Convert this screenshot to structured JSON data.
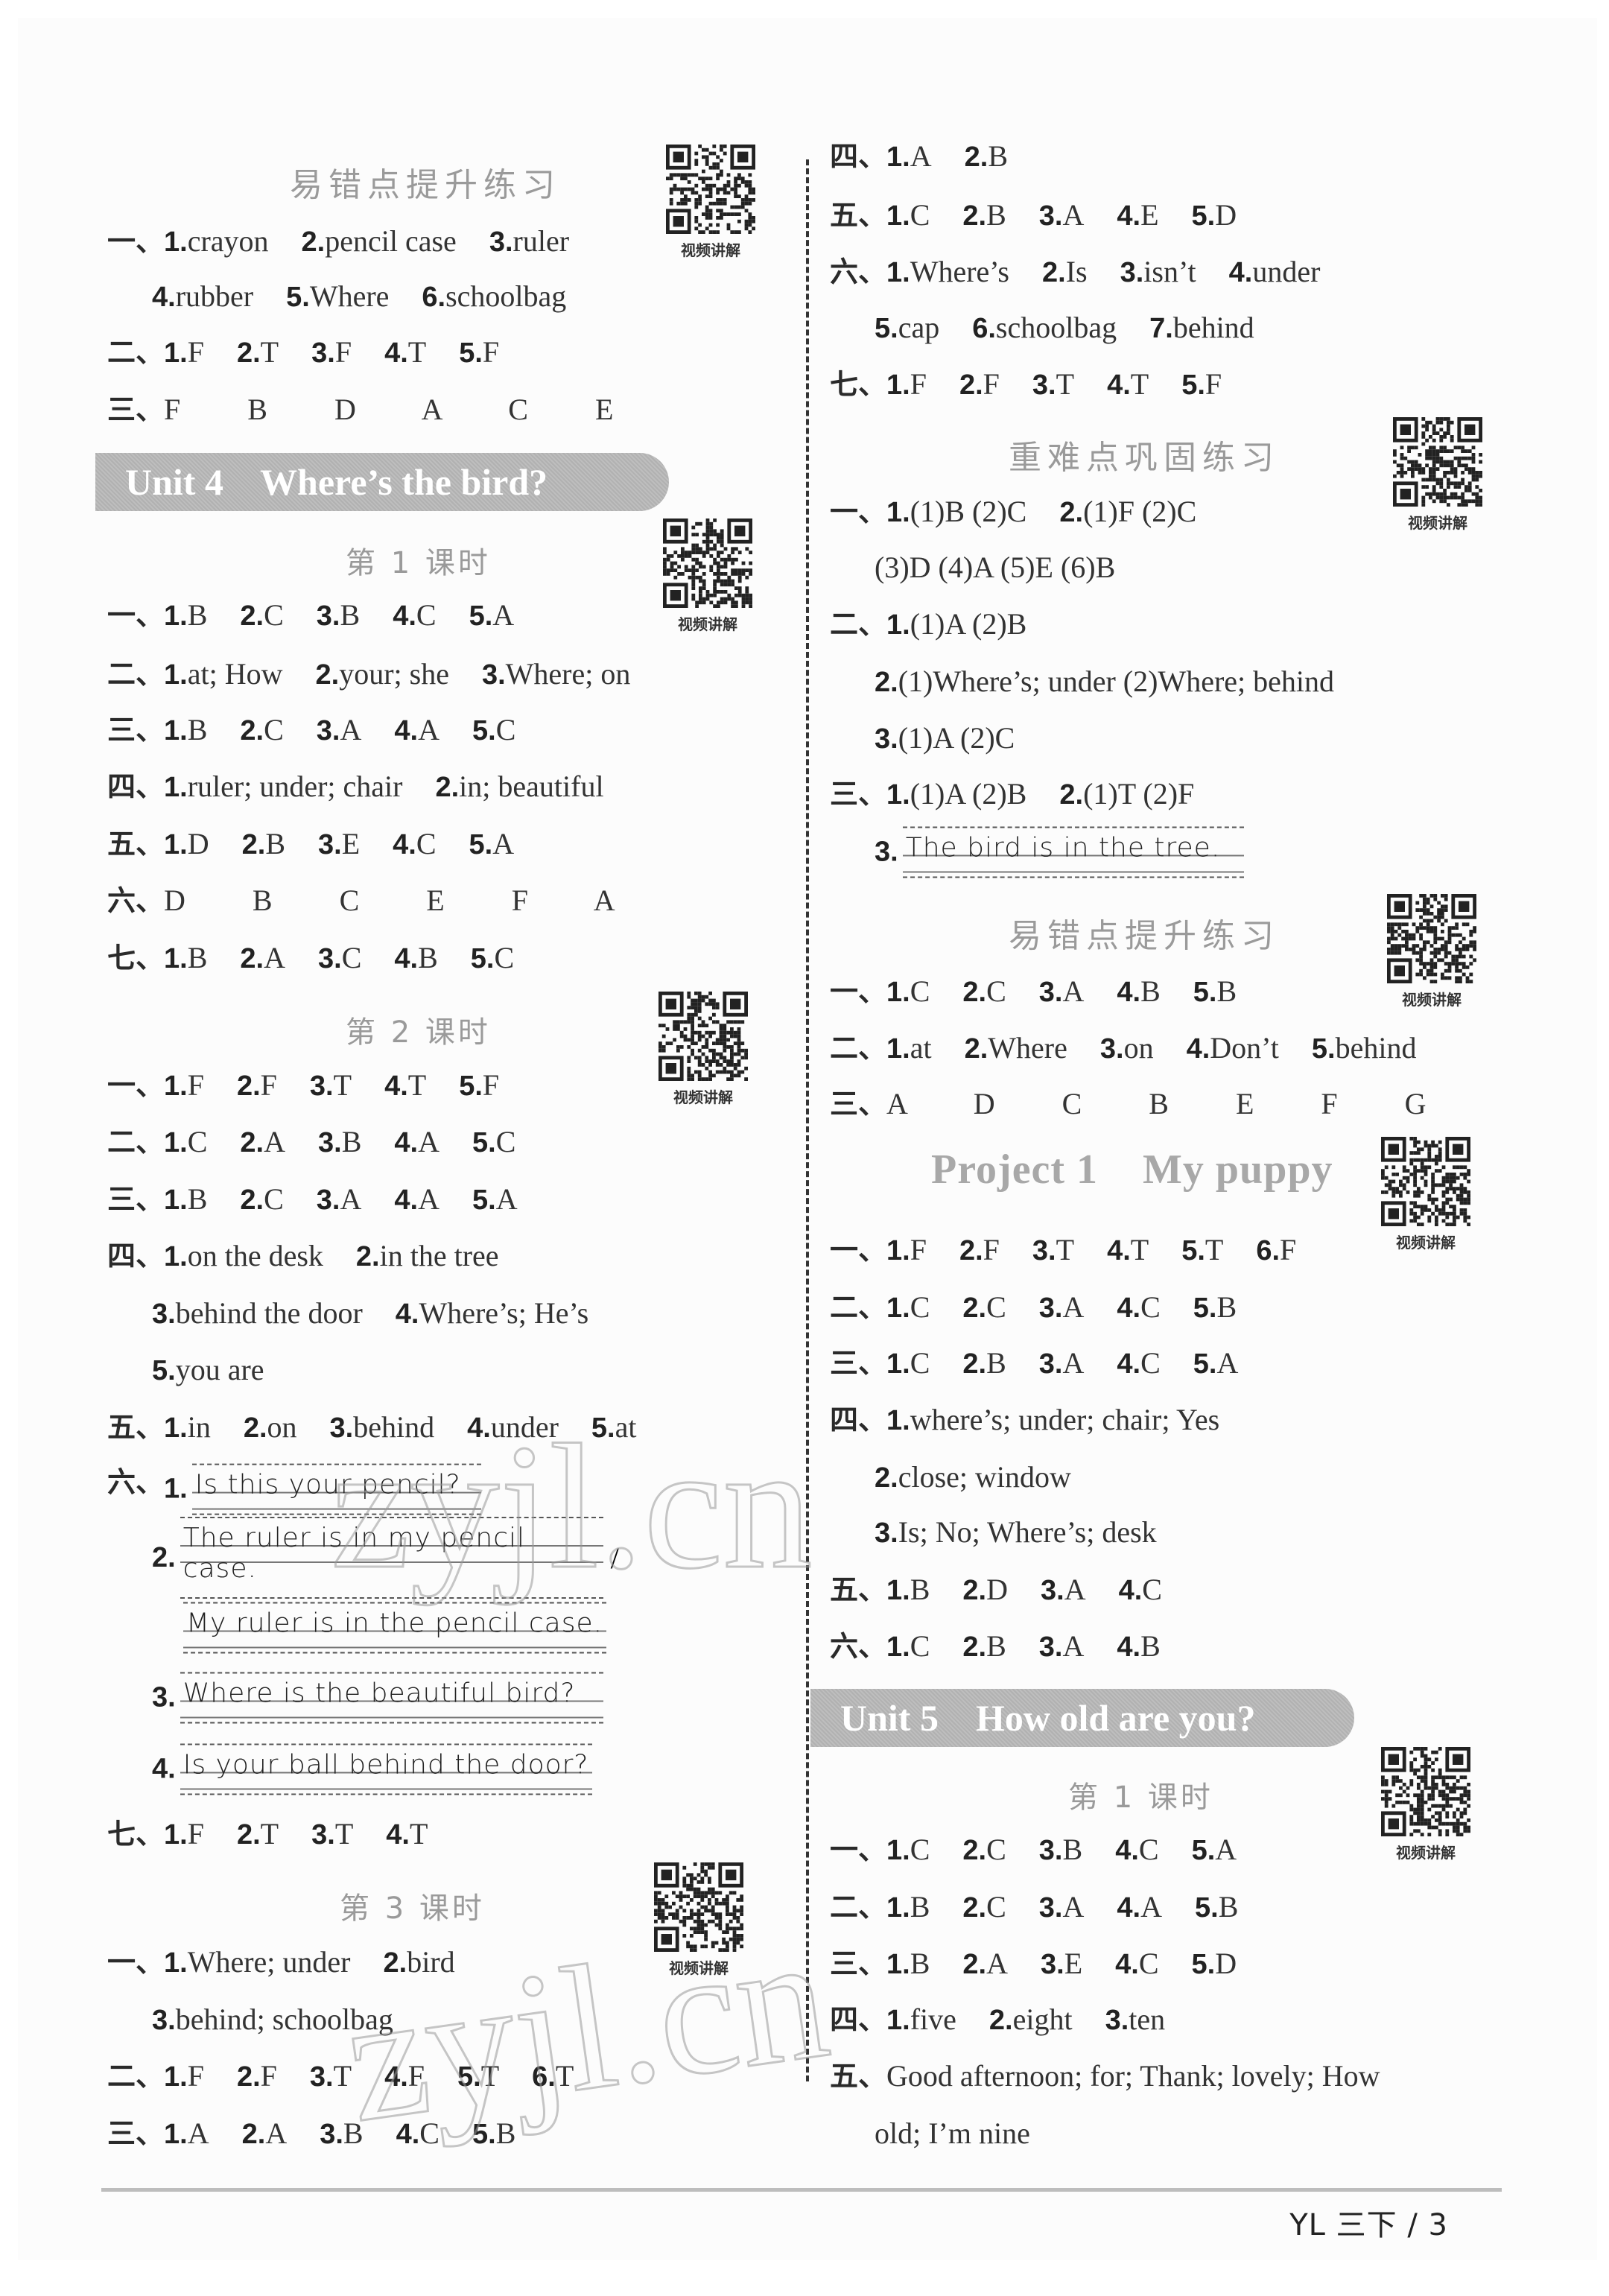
{
  "footer": "YL 三下 / 3",
  "qr_label": "视频讲解",
  "watermark": "zyjl.cn",
  "left": {
    "section_error1": "易错点提升练习",
    "error1_rows": [
      {
        "marker": "一、",
        "items": [
          {
            "n": "1.",
            "a": "crayon"
          },
          {
            "n": "2.",
            "a": "pencil case"
          },
          {
            "n": "3.",
            "a": "ruler"
          }
        ]
      },
      {
        "marker": "",
        "items": [
          {
            "n": "4.",
            "a": "rubber"
          },
          {
            "n": "5.",
            "a": "Where"
          },
          {
            "n": "6.",
            "a": "schoolbag"
          }
        ]
      },
      {
        "marker": "二、",
        "items": [
          {
            "n": "1.",
            "a": "F"
          },
          {
            "n": "2.",
            "a": "T"
          },
          {
            "n": "3.",
            "a": "F"
          },
          {
            "n": "4.",
            "a": "T"
          },
          {
            "n": "5.",
            "a": "F"
          }
        ]
      },
      {
        "marker": "三、",
        "letters": "F B D A C E"
      }
    ],
    "unit4_banner": "Unit 4    Where’s the bird?",
    "lesson1_title": "第 1 课时",
    "lesson1_rows": [
      {
        "marker": "一、",
        "items": [
          {
            "n": "1.",
            "a": "B"
          },
          {
            "n": "2.",
            "a": "C"
          },
          {
            "n": "3.",
            "a": "B"
          },
          {
            "n": "4.",
            "a": "C"
          },
          {
            "n": "5.",
            "a": "A"
          }
        ]
      },
      {
        "marker": "二、",
        "items": [
          {
            "n": "1.",
            "a": "at; How"
          },
          {
            "n": "2.",
            "a": "your; she"
          },
          {
            "n": "3.",
            "a": "Where; on"
          }
        ]
      },
      {
        "marker": "三、",
        "items": [
          {
            "n": "1.",
            "a": "B"
          },
          {
            "n": "2.",
            "a": "C"
          },
          {
            "n": "3.",
            "a": "A"
          },
          {
            "n": "4.",
            "a": "A"
          },
          {
            "n": "5.",
            "a": "C"
          }
        ]
      },
      {
        "marker": "四、",
        "items": [
          {
            "n": "1.",
            "a": "ruler; under; chair"
          },
          {
            "n": "2.",
            "a": "in; beautiful"
          }
        ]
      },
      {
        "marker": "五、",
        "items": [
          {
            "n": "1.",
            "a": "D"
          },
          {
            "n": "2.",
            "a": "B"
          },
          {
            "n": "3.",
            "a": "E"
          },
          {
            "n": "4.",
            "a": "C"
          },
          {
            "n": "5.",
            "a": "A"
          }
        ]
      },
      {
        "marker": "六、",
        "letters": "D B C E F A"
      },
      {
        "marker": "七、",
        "items": [
          {
            "n": "1.",
            "a": "B"
          },
          {
            "n": "2.",
            "a": "A"
          },
          {
            "n": "3.",
            "a": "C"
          },
          {
            "n": "4.",
            "a": "B"
          },
          {
            "n": "5.",
            "a": "C"
          }
        ]
      }
    ],
    "lesson2_title": "第 2 课时",
    "lesson2_rows": [
      {
        "marker": "一、",
        "items": [
          {
            "n": "1.",
            "a": "F"
          },
          {
            "n": "2.",
            "a": "F"
          },
          {
            "n": "3.",
            "a": "T"
          },
          {
            "n": "4.",
            "a": "T"
          },
          {
            "n": "5.",
            "a": "F"
          }
        ]
      },
      {
        "marker": "二、",
        "items": [
          {
            "n": "1.",
            "a": "C"
          },
          {
            "n": "2.",
            "a": "A"
          },
          {
            "n": "3.",
            "a": "B"
          },
          {
            "n": "4.",
            "a": "A"
          },
          {
            "n": "5.",
            "a": "C"
          }
        ]
      },
      {
        "marker": "三、",
        "items": [
          {
            "n": "1.",
            "a": "B"
          },
          {
            "n": "2.",
            "a": "C"
          },
          {
            "n": "3.",
            "a": "A"
          },
          {
            "n": "4.",
            "a": "A"
          },
          {
            "n": "5.",
            "a": "A"
          }
        ]
      },
      {
        "marker": "四、",
        "items": [
          {
            "n": "1.",
            "a": "on the desk"
          },
          {
            "n": "2.",
            "a": "in the tree"
          }
        ]
      },
      {
        "marker": "",
        "items": [
          {
            "n": "3.",
            "a": "behind the door"
          },
          {
            "n": "4.",
            "a": "Where’s; He’s"
          }
        ]
      },
      {
        "marker": "",
        "items": [
          {
            "n": "5.",
            "a": "you are"
          }
        ]
      },
      {
        "marker": "五、",
        "items": [
          {
            "n": "1.",
            "a": "in"
          },
          {
            "n": "2.",
            "a": "on"
          },
          {
            "n": "3.",
            "a": "behind"
          },
          {
            "n": "4.",
            "a": "under"
          },
          {
            "n": "5.",
            "a": "at"
          }
        ]
      }
    ],
    "lesson2_handwriting": [
      {
        "marker": "六、",
        "n": "1.",
        "text": "Is this your pencil?",
        "slash": false
      },
      {
        "marker": "",
        "n": "2.",
        "text": "The ruler is in my pencil case.",
        "slash": true
      },
      {
        "marker": "",
        "n": "",
        "text": "My ruler is in the pencil case.",
        "slash": false
      },
      {
        "marker": "",
        "n": "3.",
        "text": "Where is the beautiful bird?",
        "slash": false
      },
      {
        "marker": "",
        "n": "4.",
        "text": "Is your ball behind the door?",
        "slash": false
      }
    ],
    "lesson2_row7": {
      "marker": "七、",
      "items": [
        {
          "n": "1.",
          "a": "F"
        },
        {
          "n": "2.",
          "a": "T"
        },
        {
          "n": "3.",
          "a": "T"
        },
        {
          "n": "4.",
          "a": "T"
        }
      ]
    },
    "lesson3_title": "第 3 课时",
    "lesson3_rows": [
      {
        "marker": "一、",
        "items": [
          {
            "n": "1.",
            "a": "Where; under"
          },
          {
            "n": "2.",
            "a": "bird"
          }
        ]
      },
      {
        "marker": "",
        "items": [
          {
            "n": "3.",
            "a": "behind; schoolbag"
          }
        ]
      },
      {
        "marker": "二、",
        "items": [
          {
            "n": "1.",
            "a": "F"
          },
          {
            "n": "2.",
            "a": "F"
          },
          {
            "n": "3.",
            "a": "T"
          },
          {
            "n": "4.",
            "a": "F"
          },
          {
            "n": "5.",
            "a": "T"
          },
          {
            "n": "6.",
            "a": "T"
          }
        ]
      },
      {
        "marker": "三、",
        "items": [
          {
            "n": "1.",
            "a": "A"
          },
          {
            "n": "2.",
            "a": "A"
          },
          {
            "n": "3.",
            "a": "B"
          },
          {
            "n": "4.",
            "a": "C"
          },
          {
            "n": "5.",
            "a": "B"
          }
        ]
      }
    ]
  },
  "right": {
    "top_rows": [
      {
        "marker": "四、",
        "items": [
          {
            "n": "1.",
            "a": "A"
          },
          {
            "n": "2.",
            "a": "B"
          }
        ]
      },
      {
        "marker": "五、",
        "items": [
          {
            "n": "1.",
            "a": "C"
          },
          {
            "n": "2.",
            "a": "B"
          },
          {
            "n": "3.",
            "a": "A"
          },
          {
            "n": "4.",
            "a": "E"
          },
          {
            "n": "5.",
            "a": "D"
          }
        ]
      },
      {
        "marker": "六、",
        "items": [
          {
            "n": "1.",
            "a": "Where’s"
          },
          {
            "n": "2.",
            "a": "Is"
          },
          {
            "n": "3.",
            "a": "isn’t"
          },
          {
            "n": "4.",
            "a": "under"
          }
        ]
      },
      {
        "marker": "",
        "items": [
          {
            "n": "5.",
            "a": "cap"
          },
          {
            "n": "6.",
            "a": "schoolbag"
          },
          {
            "n": "7.",
            "a": "behind"
          }
        ]
      },
      {
        "marker": "七、",
        "items": [
          {
            "n": "1.",
            "a": "F"
          },
          {
            "n": "2.",
            "a": "F"
          },
          {
            "n": "3.",
            "a": "T"
          },
          {
            "n": "4.",
            "a": "T"
          },
          {
            "n": "5.",
            "a": "F"
          }
        ]
      }
    ],
    "section_key": "重难点巩固练习",
    "key_rows": [
      {
        "marker": "一、",
        "items": [
          {
            "n": "1.",
            "a": "(1)B   (2)C"
          },
          {
            "n": "2.",
            "a": "(1)F   (2)C"
          }
        ]
      },
      {
        "marker": "",
        "items": [
          {
            "n": "",
            "a": "(3)D   (4)A   (5)E   (6)B"
          }
        ]
      },
      {
        "marker": "二、",
        "items": [
          {
            "n": "1.",
            "a": "(1)A   (2)B"
          }
        ]
      },
      {
        "marker": "",
        "items": [
          {
            "n": "2.",
            "a": "(1)Where’s; under   (2)Where; behind"
          }
        ]
      },
      {
        "marker": "",
        "items": [
          {
            "n": "3.",
            "a": "(1)A   (2)C"
          }
        ]
      },
      {
        "marker": "三、",
        "items": [
          {
            "n": "1.",
            "a": "(1)A   (2)B"
          },
          {
            "n": "2.",
            "a": "(1)T (2)F"
          }
        ]
      }
    ],
    "key_handwriting": {
      "n": "3.",
      "text": "The bird is in the tree."
    },
    "section_error2": "易错点提升练习",
    "error2_rows": [
      {
        "marker": "一、",
        "items": [
          {
            "n": "1.",
            "a": "C"
          },
          {
            "n": "2.",
            "a": "C"
          },
          {
            "n": "3.",
            "a": "A"
          },
          {
            "n": "4.",
            "a": "B"
          },
          {
            "n": "5.",
            "a": "B"
          }
        ]
      },
      {
        "marker": "二、",
        "items": [
          {
            "n": "1.",
            "a": "at"
          },
          {
            "n": "2.",
            "a": "Where"
          },
          {
            "n": "3.",
            "a": "on"
          },
          {
            "n": "4.",
            "a": "Don’t"
          },
          {
            "n": "5.",
            "a": "behind"
          }
        ]
      },
      {
        "marker": "三、",
        "letters": "A D C B E F G"
      }
    ],
    "project_title": "Project 1    My puppy",
    "project_rows": [
      {
        "marker": "一、",
        "items": [
          {
            "n": "1.",
            "a": "F"
          },
          {
            "n": "2.",
            "a": "F"
          },
          {
            "n": "3.",
            "a": "T"
          },
          {
            "n": "4.",
            "a": "T"
          },
          {
            "n": "5.",
            "a": "T"
          },
          {
            "n": "6.",
            "a": "F"
          }
        ]
      },
      {
        "marker": "二、",
        "items": [
          {
            "n": "1.",
            "a": "C"
          },
          {
            "n": "2.",
            "a": "C"
          },
          {
            "n": "3.",
            "a": "A"
          },
          {
            "n": "4.",
            "a": "C"
          },
          {
            "n": "5.",
            "a": "B"
          }
        ]
      },
      {
        "marker": "三、",
        "items": [
          {
            "n": "1.",
            "a": "C"
          },
          {
            "n": "2.",
            "a": "B"
          },
          {
            "n": "3.",
            "a": "A"
          },
          {
            "n": "4.",
            "a": "C"
          },
          {
            "n": "5.",
            "a": "A"
          }
        ]
      },
      {
        "marker": "四、",
        "items": [
          {
            "n": "1.",
            "a": "where’s; under; chair; Yes"
          }
        ]
      },
      {
        "marker": "",
        "items": [
          {
            "n": "2.",
            "a": "close; window"
          }
        ]
      },
      {
        "marker": "",
        "items": [
          {
            "n": "3.",
            "a": "Is; No; Where’s; desk"
          }
        ]
      },
      {
        "marker": "五、",
        "items": [
          {
            "n": "1.",
            "a": "B"
          },
          {
            "n": "2.",
            "a": "D"
          },
          {
            "n": "3.",
            "a": "A"
          },
          {
            "n": "4.",
            "a": "C"
          }
        ]
      },
      {
        "marker": "六、",
        "items": [
          {
            "n": "1.",
            "a": "C"
          },
          {
            "n": "2.",
            "a": "B"
          },
          {
            "n": "3.",
            "a": "A"
          },
          {
            "n": "4.",
            "a": "B"
          }
        ]
      }
    ],
    "unit5_banner": "Unit 5    How old are you?",
    "u5_lesson1_title": "第 1 课时",
    "u5_lesson1_rows": [
      {
        "marker": "一、",
        "items": [
          {
            "n": "1.",
            "a": "C"
          },
          {
            "n": "2.",
            "a": "C"
          },
          {
            "n": "3.",
            "a": "B"
          },
          {
            "n": "4.",
            "a": "C"
          },
          {
            "n": "5.",
            "a": "A"
          }
        ]
      },
      {
        "marker": "二、",
        "items": [
          {
            "n": "1.",
            "a": "B"
          },
          {
            "n": "2.",
            "a": "C"
          },
          {
            "n": "3.",
            "a": "A"
          },
          {
            "n": "4.",
            "a": "A"
          },
          {
            "n": "5.",
            "a": "B"
          }
        ]
      },
      {
        "marker": "三、",
        "items": [
          {
            "n": "1.",
            "a": "B"
          },
          {
            "n": "2.",
            "a": "A"
          },
          {
            "n": "3.",
            "a": "E"
          },
          {
            "n": "4.",
            "a": "C"
          },
          {
            "n": "5.",
            "a": "D"
          }
        ]
      },
      {
        "marker": "四、",
        "items": [
          {
            "n": "1.",
            "a": "five"
          },
          {
            "n": "2.",
            "a": "eight"
          },
          {
            "n": "3.",
            "a": "ten"
          }
        ]
      },
      {
        "marker": "五、",
        "items": [
          {
            "n": "",
            "a": "Good afternoon; for; Thank; lovely; How"
          }
        ]
      },
      {
        "marker": "",
        "items": [
          {
            "n": "",
            "a": "old; I’m nine"
          }
        ]
      }
    ]
  }
}
